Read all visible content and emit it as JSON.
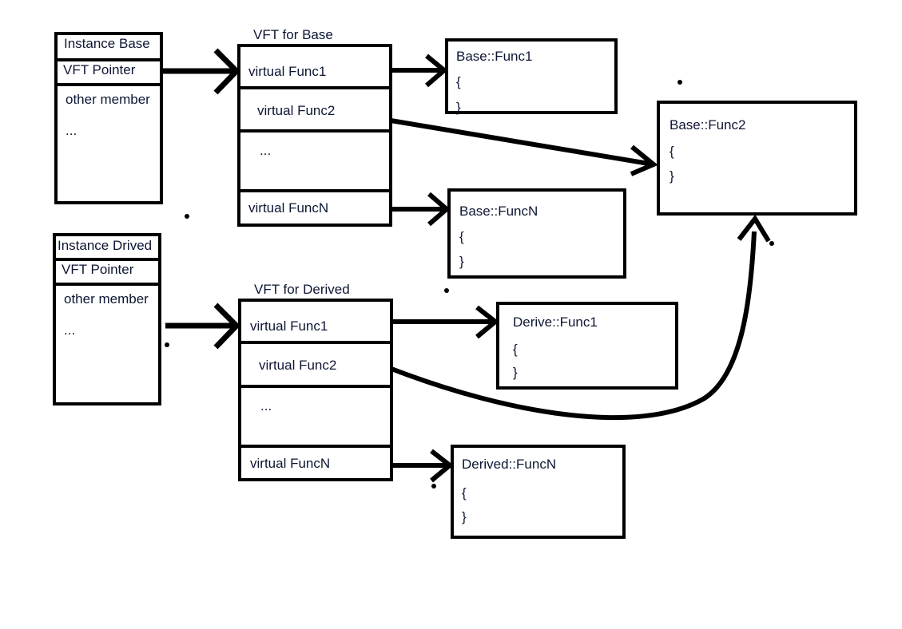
{
  "diagram": {
    "title_hidden": "C++ virtual function table (VFT) dispatch diagram",
    "stroke_color": "#000000",
    "text_color": "#0d1633",
    "background": "#ffffff"
  },
  "instance_base": {
    "header": "Instance Base",
    "vft_pointer": "VFT Pointer",
    "other_member": "other member",
    "ellipsis": "..."
  },
  "instance_derived": {
    "header": "Instance Drived",
    "vft_pointer": "VFT Pointer",
    "other_member": "other member",
    "ellipsis": "..."
  },
  "vft_base": {
    "caption": "VFT for Base",
    "rows": [
      {
        "label": "virtual Func1"
      },
      {
        "label": "virtual Func2"
      },
      {
        "label": "..."
      },
      {
        "label": "virtual FuncN"
      }
    ]
  },
  "vft_derived": {
    "caption": "VFT for Derived",
    "rows": [
      {
        "label": "virtual Func1"
      },
      {
        "label": "virtual Func2"
      },
      {
        "label": "..."
      },
      {
        "label": "virtual FuncN"
      }
    ]
  },
  "functions": {
    "base_func1": {
      "signature": "Base::Func1",
      "open_brace": "{",
      "close_brace": "}"
    },
    "base_func2": {
      "signature": "Base::Func2",
      "open_brace": "{",
      "close_brace": "}"
    },
    "base_funcN": {
      "signature": "Base::FuncN",
      "open_brace": "{",
      "close_brace": "}"
    },
    "derive_func1": {
      "signature": "Derive::Func1",
      "open_brace": "{",
      "close_brace": "}"
    },
    "derived_funcN": {
      "signature": "Derived::FuncN",
      "open_brace": "{",
      "close_brace": "}"
    }
  }
}
